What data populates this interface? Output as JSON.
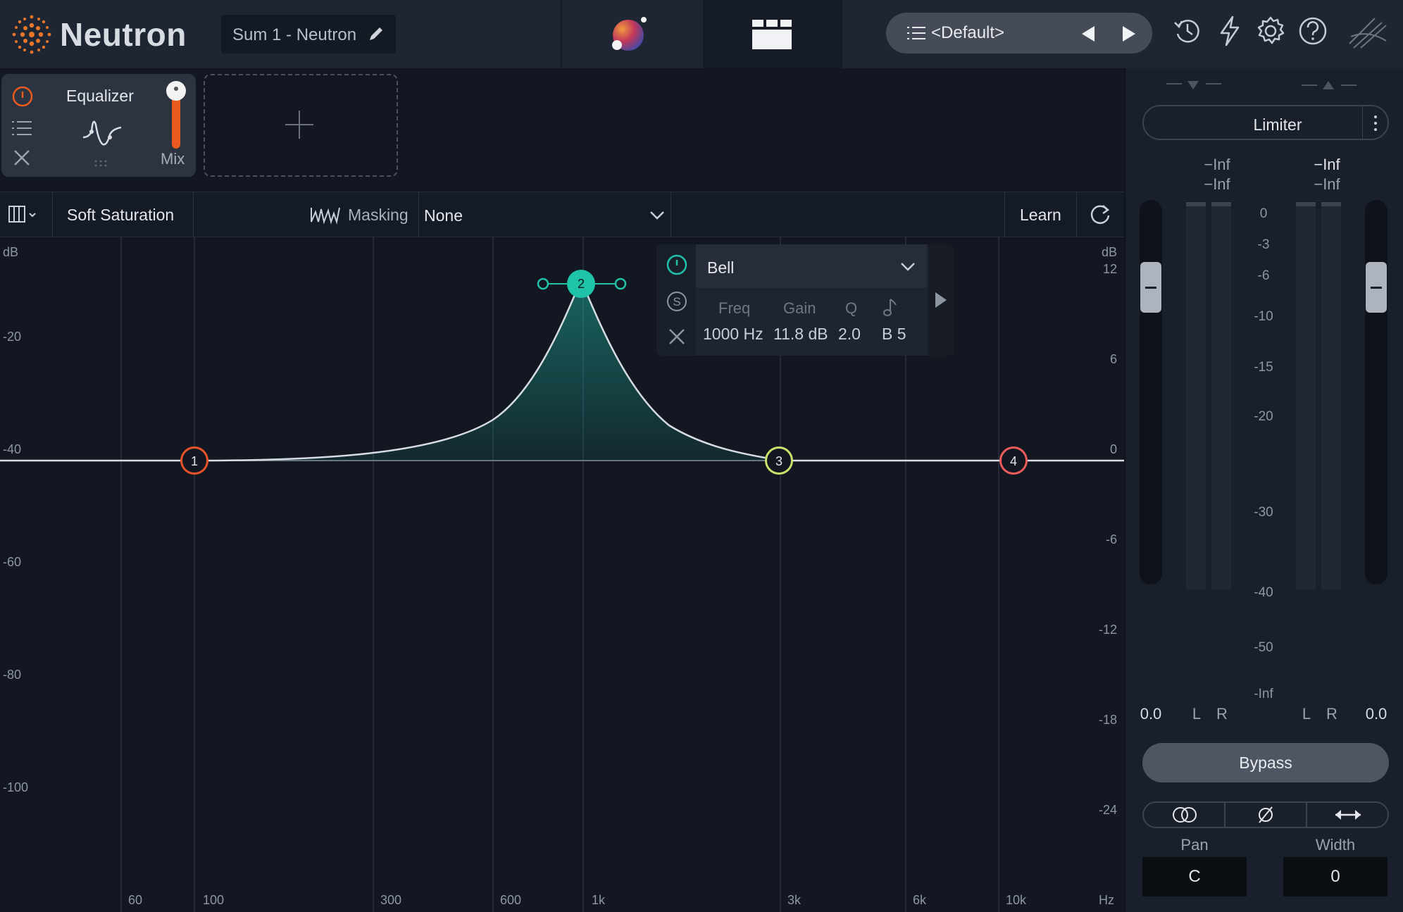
{
  "app": {
    "name": "Neutron",
    "instance_name": "Sum 1 - Neutron",
    "preset": "<Default>"
  },
  "module": {
    "title": "Equalizer",
    "mix_label": "Mix",
    "mix_level": 1.0
  },
  "toolbar": {
    "soft_saturation": "Soft Saturation",
    "masking_label": "Masking",
    "masking_value": "None",
    "learn_label": "Learn"
  },
  "graph": {
    "left_db_unit": "dB",
    "left_scale": [
      "-20",
      "-40",
      "-60",
      "-80",
      "-100"
    ],
    "right_db_unit": "dB",
    "right_scale": [
      "12",
      "6",
      "0",
      "-6",
      "-12",
      "-18",
      "-24"
    ],
    "freq_labels": [
      "60",
      "100",
      "300",
      "600",
      "1k",
      "3k",
      "6k",
      "10k"
    ],
    "freq_unit": "Hz",
    "bands": [
      {
        "number": "1",
        "color": "#e8542a"
      },
      {
        "number": "2",
        "color": "#1fc3a8"
      },
      {
        "number": "3",
        "color": "#c8e26a"
      },
      {
        "number": "4",
        "color": "#ee5b5b"
      }
    ]
  },
  "band_popup": {
    "type": "Bell",
    "headers": {
      "freq": "Freq",
      "gain": "Gain",
      "q": "Q"
    },
    "values": {
      "freq": "1000 Hz",
      "gain": "11.8 dB",
      "q": "2.0",
      "note": "B 5"
    }
  },
  "right_panel": {
    "limiter_label": "Limiter",
    "input_peak_top": "−Inf",
    "input_peak_bottom": "−Inf",
    "output_peak_top": "−Inf",
    "output_peak_bottom": "−Inf",
    "meter_scale": [
      "0",
      "-3",
      "-6",
      "-10",
      "-15",
      "-20",
      "-30",
      "-40",
      "-50",
      "-Inf"
    ],
    "input_gain": "0.0",
    "output_gain": "0.0",
    "channel_l": "L",
    "channel_r": "R",
    "bypass_label": "Bypass",
    "pan_label": "Pan",
    "width_label": "Width",
    "pan_value": "C",
    "width_value": "0"
  },
  "colors": {
    "accent_orange": "#e95a1e",
    "accent_teal": "#1fc3a8",
    "background": "#121722"
  }
}
